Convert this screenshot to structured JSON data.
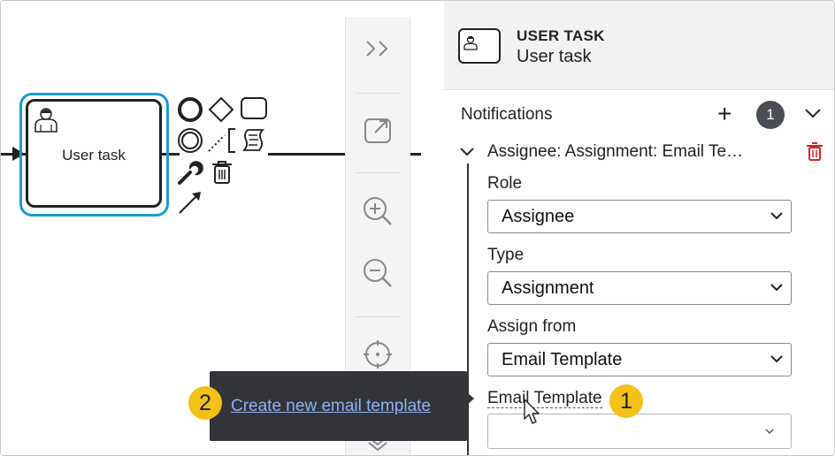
{
  "canvas": {
    "task_label": "User task"
  },
  "panel": {
    "header": {
      "type": "USER TASK",
      "name": "User task"
    },
    "notifications": {
      "title": "Notifications",
      "add_symbol": "+",
      "count": "1",
      "item_title": "Assignee: Assignment: Email Te…",
      "fields": {
        "role_label": "Role",
        "role_value": "Assignee",
        "type_label": "Type",
        "type_value": "Assignment",
        "assign_from_label": "Assign from",
        "assign_from_value": "Email Template",
        "email_template_label": "Email Template",
        "email_template_value": ""
      }
    }
  },
  "tooltip": {
    "link_text": "Create new email template"
  },
  "callouts": {
    "first": "1",
    "second": "2"
  },
  "colors": {
    "selection": "#1a9cd8",
    "callout": "#f3c117",
    "delete": "#d8232a",
    "link": "#8db4f5",
    "tooltip_bg": "#323437"
  }
}
